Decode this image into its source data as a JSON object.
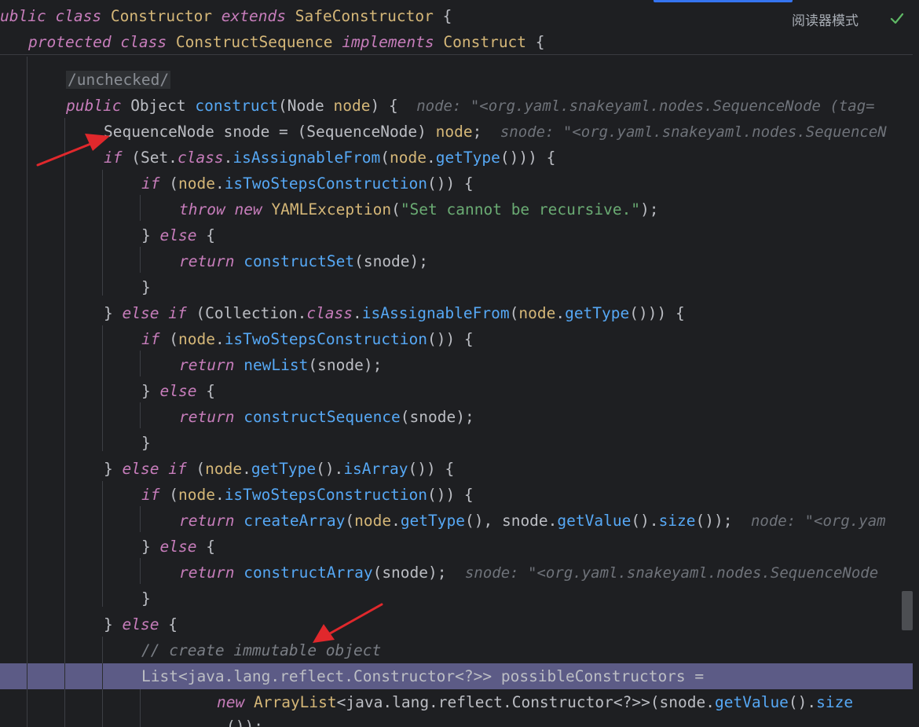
{
  "toolbar": {
    "reader_mode_label": "阅读器模式",
    "check_icon": "check-icon"
  },
  "code": {
    "l1": [
      "ublic",
      " ",
      "class",
      " ",
      "Constructor",
      " ",
      "extends",
      " ",
      "SafeConstructor",
      " {"
    ],
    "l2": [
      "protected",
      " ",
      "class",
      " ",
      "ConstructSequence",
      " ",
      "implements",
      " ",
      "Construct",
      " {"
    ],
    "l3": "/unchecked/",
    "l4": [
      "public",
      " Object ",
      "construct",
      "(Node ",
      "node",
      ") {",
      "node: \"<org.yaml.snakeyaml.nodes.SequenceNode (tag="
    ],
    "l5": [
      "SequenceNode snode = (SequenceNode) ",
      "node",
      ";",
      "snode: \"<org.yaml.snakeyaml.nodes.SequenceN"
    ],
    "l6": [
      "if",
      " (Set.",
      "class",
      ".",
      "isAssignableFrom",
      "(",
      "node",
      ".",
      "getType",
      "())) {"
    ],
    "l7": [
      "if",
      " (",
      "node",
      ".",
      "isTwoStepsConstruction",
      "()) {"
    ],
    "l8": [
      "throw",
      " ",
      "new",
      " ",
      "YAMLException",
      "(",
      "\"Set cannot be recursive.\"",
      ");"
    ],
    "l9": [
      "} ",
      "else",
      " {"
    ],
    "l10": [
      "return",
      " ",
      "constructSet",
      "(snode);"
    ],
    "l11": "}",
    "l12": [
      "} ",
      "else",
      " ",
      "if",
      " (Collection.",
      "class",
      ".",
      "isAssignableFrom",
      "(",
      "node",
      ".",
      "getType",
      "())) {"
    ],
    "l13": [
      "if",
      " (",
      "node",
      ".",
      "isTwoStepsConstruction",
      "()) {"
    ],
    "l14": [
      "return",
      " ",
      "newList",
      "(snode);"
    ],
    "l15": [
      "} ",
      "else",
      " {"
    ],
    "l16": [
      "return",
      " ",
      "constructSequence",
      "(snode);"
    ],
    "l17": "}",
    "l18": [
      "} ",
      "else",
      " ",
      "if",
      " (",
      "node",
      ".",
      "getType",
      "().",
      "isArray",
      "()) {"
    ],
    "l19": [
      "if",
      " (",
      "node",
      ".",
      "isTwoStepsConstruction",
      "()) {"
    ],
    "l20": [
      "return",
      " ",
      "createArray",
      "(",
      "node",
      ".",
      "getType",
      "(), snode.",
      "getValue",
      "().",
      "size",
      "());",
      "node: \"<org.yam"
    ],
    "l21": [
      "} ",
      "else",
      " {"
    ],
    "l22": [
      "return",
      " ",
      "constructArray",
      "(snode);",
      "snode: \"<org.yaml.snakeyaml.nodes.SequenceNode"
    ],
    "l23": "}",
    "l24": [
      "} ",
      "else",
      " {"
    ],
    "l25": "// create immutable object",
    "l26": "List<java.lang.reflect.Constructor<?>> possibleConstructors =",
    "l27": [
      "new",
      " ",
      "ArrayList",
      "<java.lang.reflect.Constructor<?>>(snode.",
      "getValue",
      "().",
      "size"
    ],
    "l28": "());"
  },
  "colors": {
    "background": "#1e1f22",
    "highlight": "#5c5b86",
    "arrow": "#e0282c"
  }
}
